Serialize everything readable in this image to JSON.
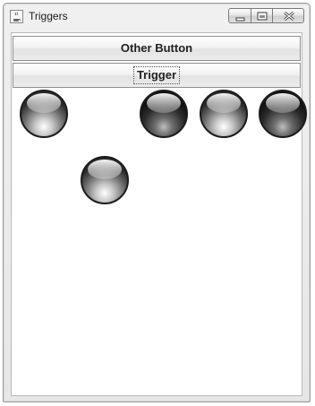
{
  "window": {
    "title": "Triggers",
    "app_icon": "java-coffee-icon",
    "controls": [
      "minimize-icon",
      "maximize-icon",
      "close-icon"
    ]
  },
  "buttons": {
    "other_label": "Other Button",
    "trigger_label": "Trigger"
  },
  "orbs": [
    {
      "shade": "light"
    },
    {
      "shade": "dark"
    },
    {
      "shade": "light"
    },
    {
      "shade": "light"
    },
    {
      "shade": "dark"
    }
  ]
}
